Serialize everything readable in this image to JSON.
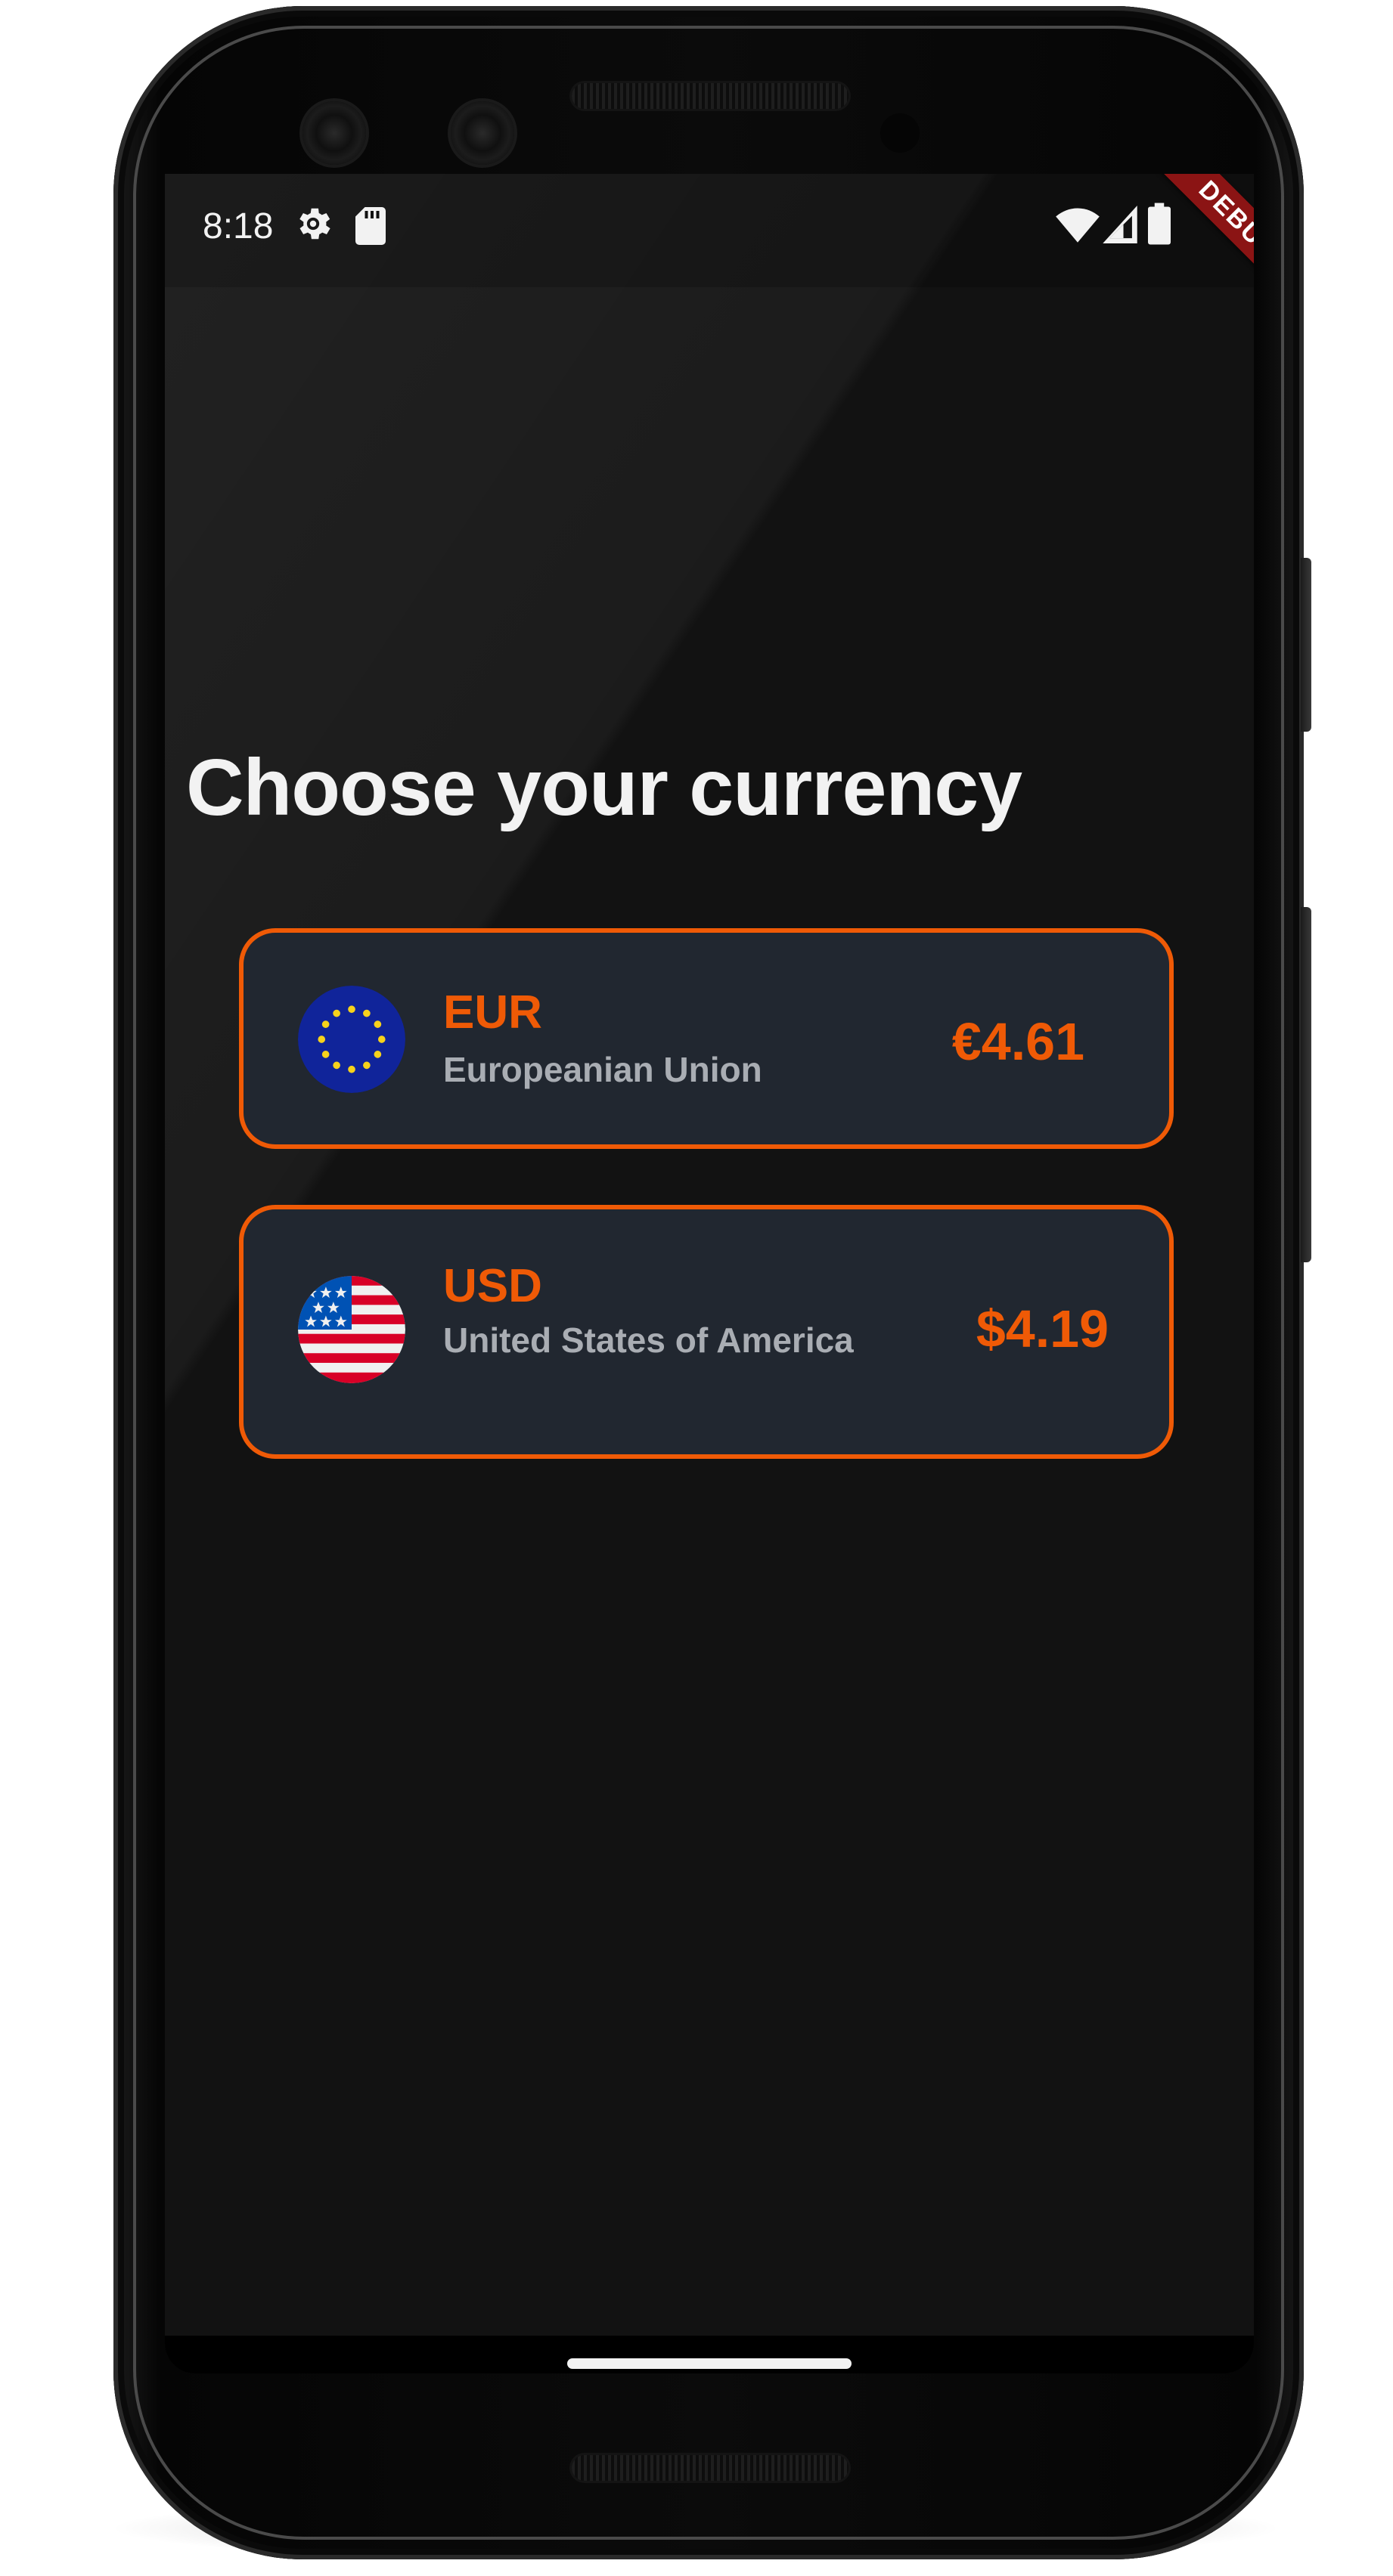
{
  "status_bar": {
    "time": "8:18"
  },
  "debug_banner": "DEBUG",
  "page": {
    "title": "Choose your currency"
  },
  "currencies": [
    {
      "code": "EUR",
      "name": "Europeanian Union",
      "amount": "€4.61",
      "flag_icon": "eu-flag-icon"
    },
    {
      "code": "USD",
      "name": "United States of America",
      "amount": "$4.19",
      "flag_icon": "us-flag-icon"
    }
  ],
  "colors": {
    "background": "#121212",
    "card_background": "#212730",
    "accent": "#ef5a06",
    "title_text": "#f2f2f2",
    "secondary_text": "#a9adb3",
    "debug_banner": "#8b1414"
  }
}
